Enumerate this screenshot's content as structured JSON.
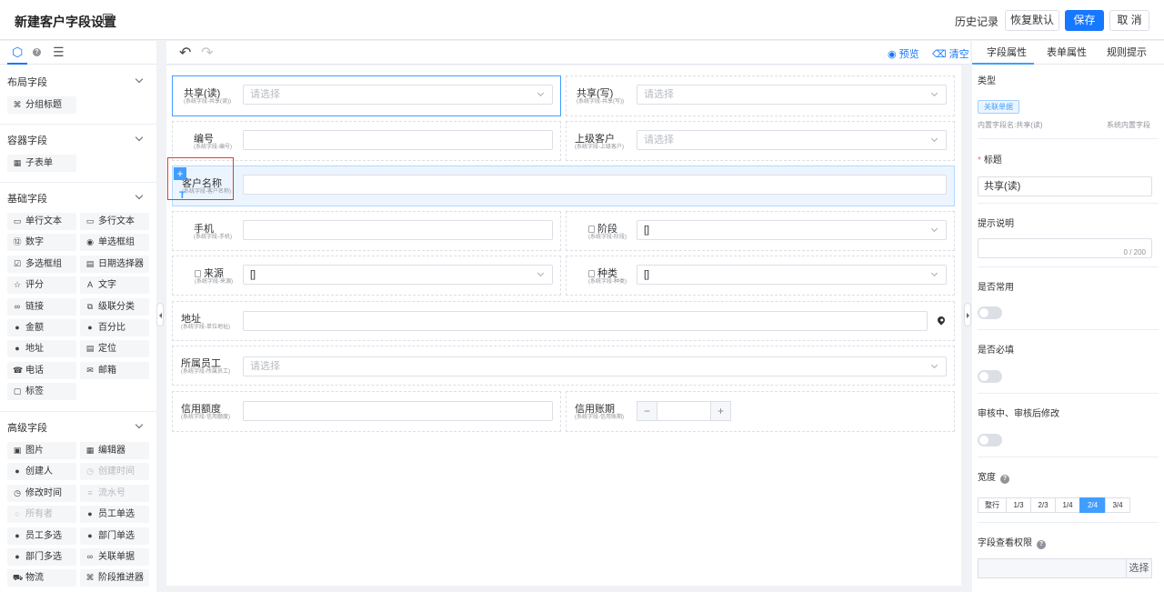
{
  "header": {
    "title": "新建客户字段设置",
    "history": "历史记录",
    "restore_default": "恢复默认",
    "save": "保存",
    "cancel": "取 消"
  },
  "palette": {
    "tabs": [
      "cube-icon",
      "help-icon",
      "tree-icon"
    ],
    "groups": [
      {
        "name": "布局字段",
        "items": [
          {
            "icon": "split-title-icon",
            "label": "分组标题"
          }
        ]
      },
      {
        "name": "容器字段",
        "items": [
          {
            "icon": "table-icon",
            "label": "子表单"
          }
        ]
      },
      {
        "name": "基础字段",
        "items": [
          {
            "icon": "single-line-icon",
            "label": "单行文本"
          },
          {
            "icon": "multi-line-icon",
            "label": "多行文本"
          },
          {
            "icon": "number-icon",
            "label": "数字"
          },
          {
            "icon": "radio-icon",
            "label": "单选框组"
          },
          {
            "icon": "checkbox-icon",
            "label": "多选框组"
          },
          {
            "icon": "calendar-icon",
            "label": "日期选择器"
          },
          {
            "icon": "star-icon",
            "label": "评分"
          },
          {
            "icon": "text-icon",
            "label": "文字"
          },
          {
            "icon": "link-icon",
            "label": "链接"
          },
          {
            "icon": "cascade-icon",
            "label": "级联分类"
          },
          {
            "icon": "money-icon",
            "label": "金额"
          },
          {
            "icon": "percent-icon",
            "label": "百分比"
          },
          {
            "icon": "location-icon",
            "label": "地址"
          },
          {
            "icon": "document-icon",
            "label": "定位"
          },
          {
            "icon": "phone-icon",
            "label": "电话"
          },
          {
            "icon": "mail-icon",
            "label": "邮箱"
          },
          {
            "icon": "tag-icon",
            "label": "标签"
          }
        ]
      },
      {
        "name": "高级字段",
        "items": [
          {
            "icon": "image-icon",
            "label": "图片"
          },
          {
            "icon": "editor-icon",
            "label": "编辑器"
          },
          {
            "icon": "user-icon",
            "label": "创建人"
          },
          {
            "icon": "clock-icon",
            "label": "创建时间",
            "disabled": true
          },
          {
            "icon": "clock-icon",
            "label": "修改时间"
          },
          {
            "icon": "serial-icon",
            "label": "流水号",
            "disabled": true
          },
          {
            "icon": "owner-icon",
            "label": "所有者",
            "disabled": true
          },
          {
            "icon": "user-icon",
            "label": "员工单选"
          },
          {
            "icon": "users-icon",
            "label": "员工多选"
          },
          {
            "icon": "users-icon",
            "label": "部门单选"
          },
          {
            "icon": "users-icon",
            "label": "部门多选"
          },
          {
            "icon": "link-icon",
            "label": "关联单据"
          },
          {
            "icon": "logistics-icon",
            "label": "物流"
          },
          {
            "icon": "stage-icon",
            "label": "阶段推进器"
          }
        ]
      }
    ]
  },
  "toolbar": {
    "preview": "预览",
    "clear": "清空"
  },
  "form": {
    "fields": [
      {
        "label": "共享(读)",
        "sub": "(系统字段-共享(读))",
        "placeholder": "请选择"
      },
      {
        "label": "共享(写)",
        "sub": "(系统字段-共享(写))",
        "placeholder": "请选择"
      },
      {
        "label": "编号",
        "sub": "(系统字段-编号)"
      },
      {
        "label": "上级客户",
        "sub": "(系统字段-上级客户)",
        "placeholder": "请选择"
      },
      {
        "label": "客户名称",
        "sub": "(系统字段-客户名称)"
      },
      {
        "label": "手机",
        "sub": "(系统字段-手机)"
      },
      {
        "label": "阶段",
        "sub": "(系统字段-阶段)",
        "value": "[]"
      },
      {
        "label": "来源",
        "sub": "(系统字段-来源)",
        "value": "[]"
      },
      {
        "label": "种类",
        "sub": "(系统字段-种类)",
        "value": "[]"
      },
      {
        "label": "地址",
        "sub": "(系统字段-单位地址)"
      },
      {
        "label": "所属员工",
        "sub": "(系统字段-所属员工)",
        "placeholder": "请选择"
      },
      {
        "label": "信用额度",
        "sub": "(系统字段-信用额度)"
      },
      {
        "label": "信用账期",
        "sub": "(系统字段-信用账期)"
      }
    ],
    "stepper_minus": "−",
    "stepper_plus": "+",
    "drag_plus": "+",
    "drag_move": "T"
  },
  "props": {
    "tabs": [
      "字段属性",
      "表单属性",
      "规则提示"
    ],
    "type_label": "类型",
    "type_tag": "关联单据",
    "builtin_name": "内置字段名:共享(读)",
    "builtin_tag": "系统内置字段",
    "title_label": "标题",
    "title_value": "共享(读)",
    "hint_label": "提示说明",
    "hint_counter": "0 / 200",
    "common_label": "是否常用",
    "required_label": "是否必填",
    "audit_label": "审核中、审核后修改",
    "width_label": "宽度",
    "width_options": [
      "整行",
      "1/3",
      "2/3",
      "1/4",
      "2/4",
      "3/4"
    ],
    "width_selected": "2/4",
    "perm_label": "字段查看权限",
    "perm_button": "选择",
    "question_mark": "?"
  }
}
